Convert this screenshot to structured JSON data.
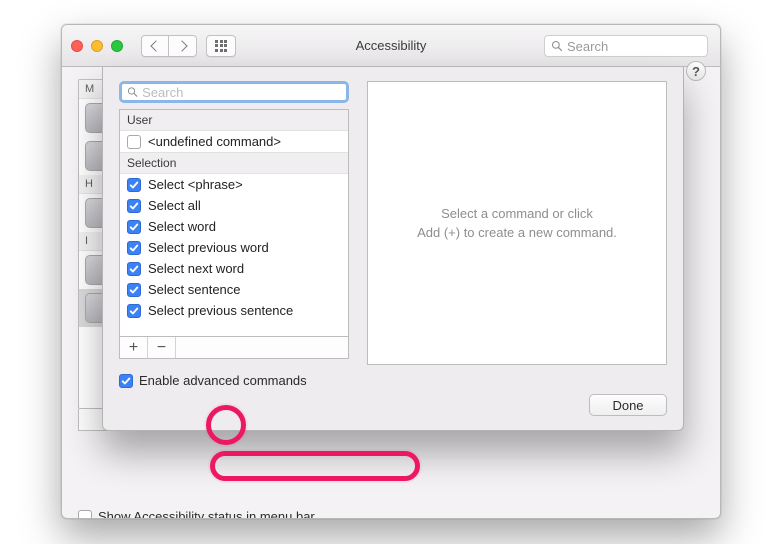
{
  "window": {
    "title": "Accessibility",
    "toolbar_search_placeholder": "Search"
  },
  "bg_sidebar": {
    "category": "M",
    "category2": "H",
    "category3": "I"
  },
  "menubar_checkbox_label": "Show Accessibility status in menu bar",
  "sheet": {
    "search_placeholder": "Search",
    "groups": [
      {
        "header": "User",
        "items": [
          {
            "label": "<undefined command>",
            "checked": false,
            "muted": true
          }
        ]
      },
      {
        "header": "Selection",
        "items": [
          {
            "label": "Select <phrase>",
            "checked": true
          },
          {
            "label": "Select all",
            "checked": true
          },
          {
            "label": "Select word",
            "checked": true
          },
          {
            "label": "Select previous word",
            "checked": true
          },
          {
            "label": "Select next word",
            "checked": true
          },
          {
            "label": "Select sentence",
            "checked": true
          },
          {
            "label": "Select previous sentence",
            "checked": true
          }
        ]
      }
    ],
    "enable_label": "Enable advanced commands",
    "enable_checked": true,
    "detail_line1": "Select a command or click",
    "detail_line2": "Add (+) to create a new command.",
    "done_label": "Done"
  },
  "help_label": "?"
}
